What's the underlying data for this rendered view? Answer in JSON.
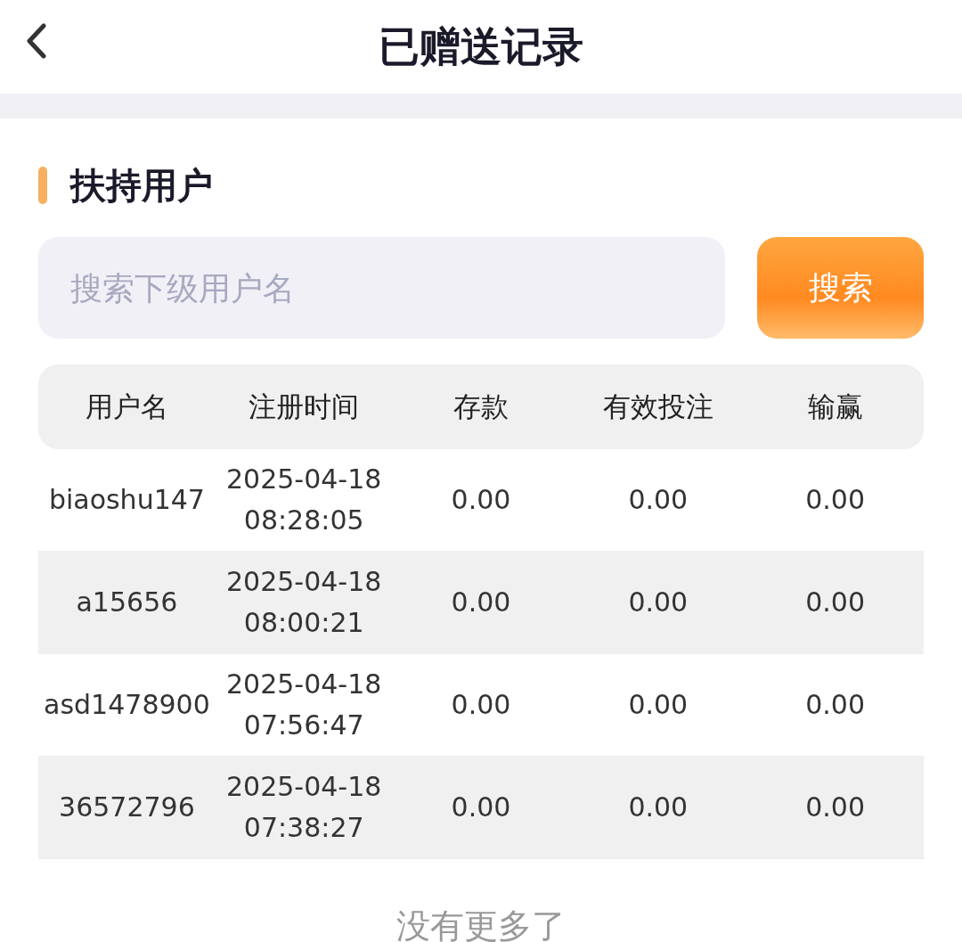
{
  "header": {
    "title": "已赠送记录"
  },
  "section": {
    "title": "扶持用户"
  },
  "search": {
    "placeholder": "搜索下级用户名",
    "button": "搜索"
  },
  "table": {
    "columns": [
      "用户名",
      "注册时间",
      "存款",
      "有效投注",
      "输赢"
    ],
    "rows": [
      {
        "cells": [
          "biaoshu147",
          "2025-04-18\n08:28:05",
          "0.00",
          "0.00",
          "0.00"
        ]
      },
      {
        "cells": [
          "a15656",
          "2025-04-18\n08:00:21",
          "0.00",
          "0.00",
          "0.00"
        ]
      },
      {
        "cells": [
          "asd1478900",
          "2025-04-18\n07:56:47",
          "0.00",
          "0.00",
          "0.00"
        ]
      },
      {
        "cells": [
          "36572796",
          "2025-04-18\n07:38:27",
          "0.00",
          "0.00",
          "0.00"
        ]
      }
    ]
  },
  "footer": "没有更多了"
}
